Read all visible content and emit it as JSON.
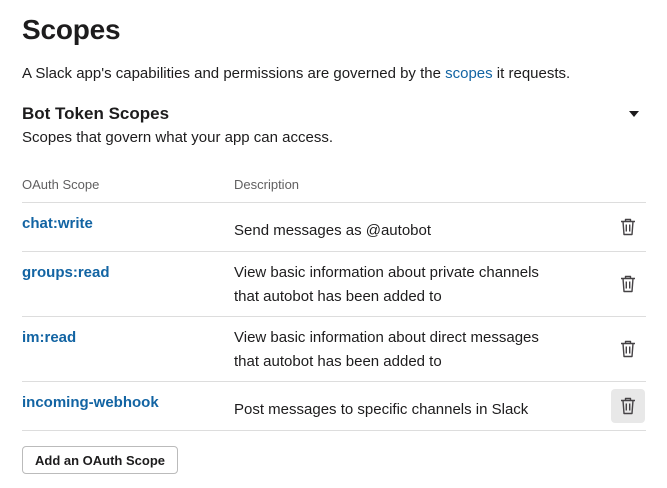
{
  "page": {
    "title": "Scopes",
    "intro_before": "A Slack app's capabilities and permissions are governed by the ",
    "intro_link": "scopes",
    "intro_after": " it requests."
  },
  "section": {
    "title": "Bot Token Scopes",
    "subtitle": "Scopes that govern what your app can access.",
    "collapse_icon": "caret-down-icon"
  },
  "table": {
    "headers": {
      "scope": "OAuth Scope",
      "description": "Description"
    },
    "rows": [
      {
        "scope": "chat:write",
        "description": "Send messages as @autobot"
      },
      {
        "scope": "groups:read",
        "description": "View basic information about private channels that autobot has been added to"
      },
      {
        "scope": "im:read",
        "description": "View basic information about direct messages that autobot has been added to"
      },
      {
        "scope": "incoming-webhook",
        "description": "Post messages to specific channels in Slack"
      }
    ],
    "delete_icon": "trash-icon"
  },
  "actions": {
    "add_scope_label": "Add an OAuth Scope"
  },
  "colors": {
    "link": "#1264a3",
    "text": "#1d1c1d",
    "muted": "#616061",
    "divider": "#dddddd",
    "hover_bg": "#e8e8e8"
  }
}
